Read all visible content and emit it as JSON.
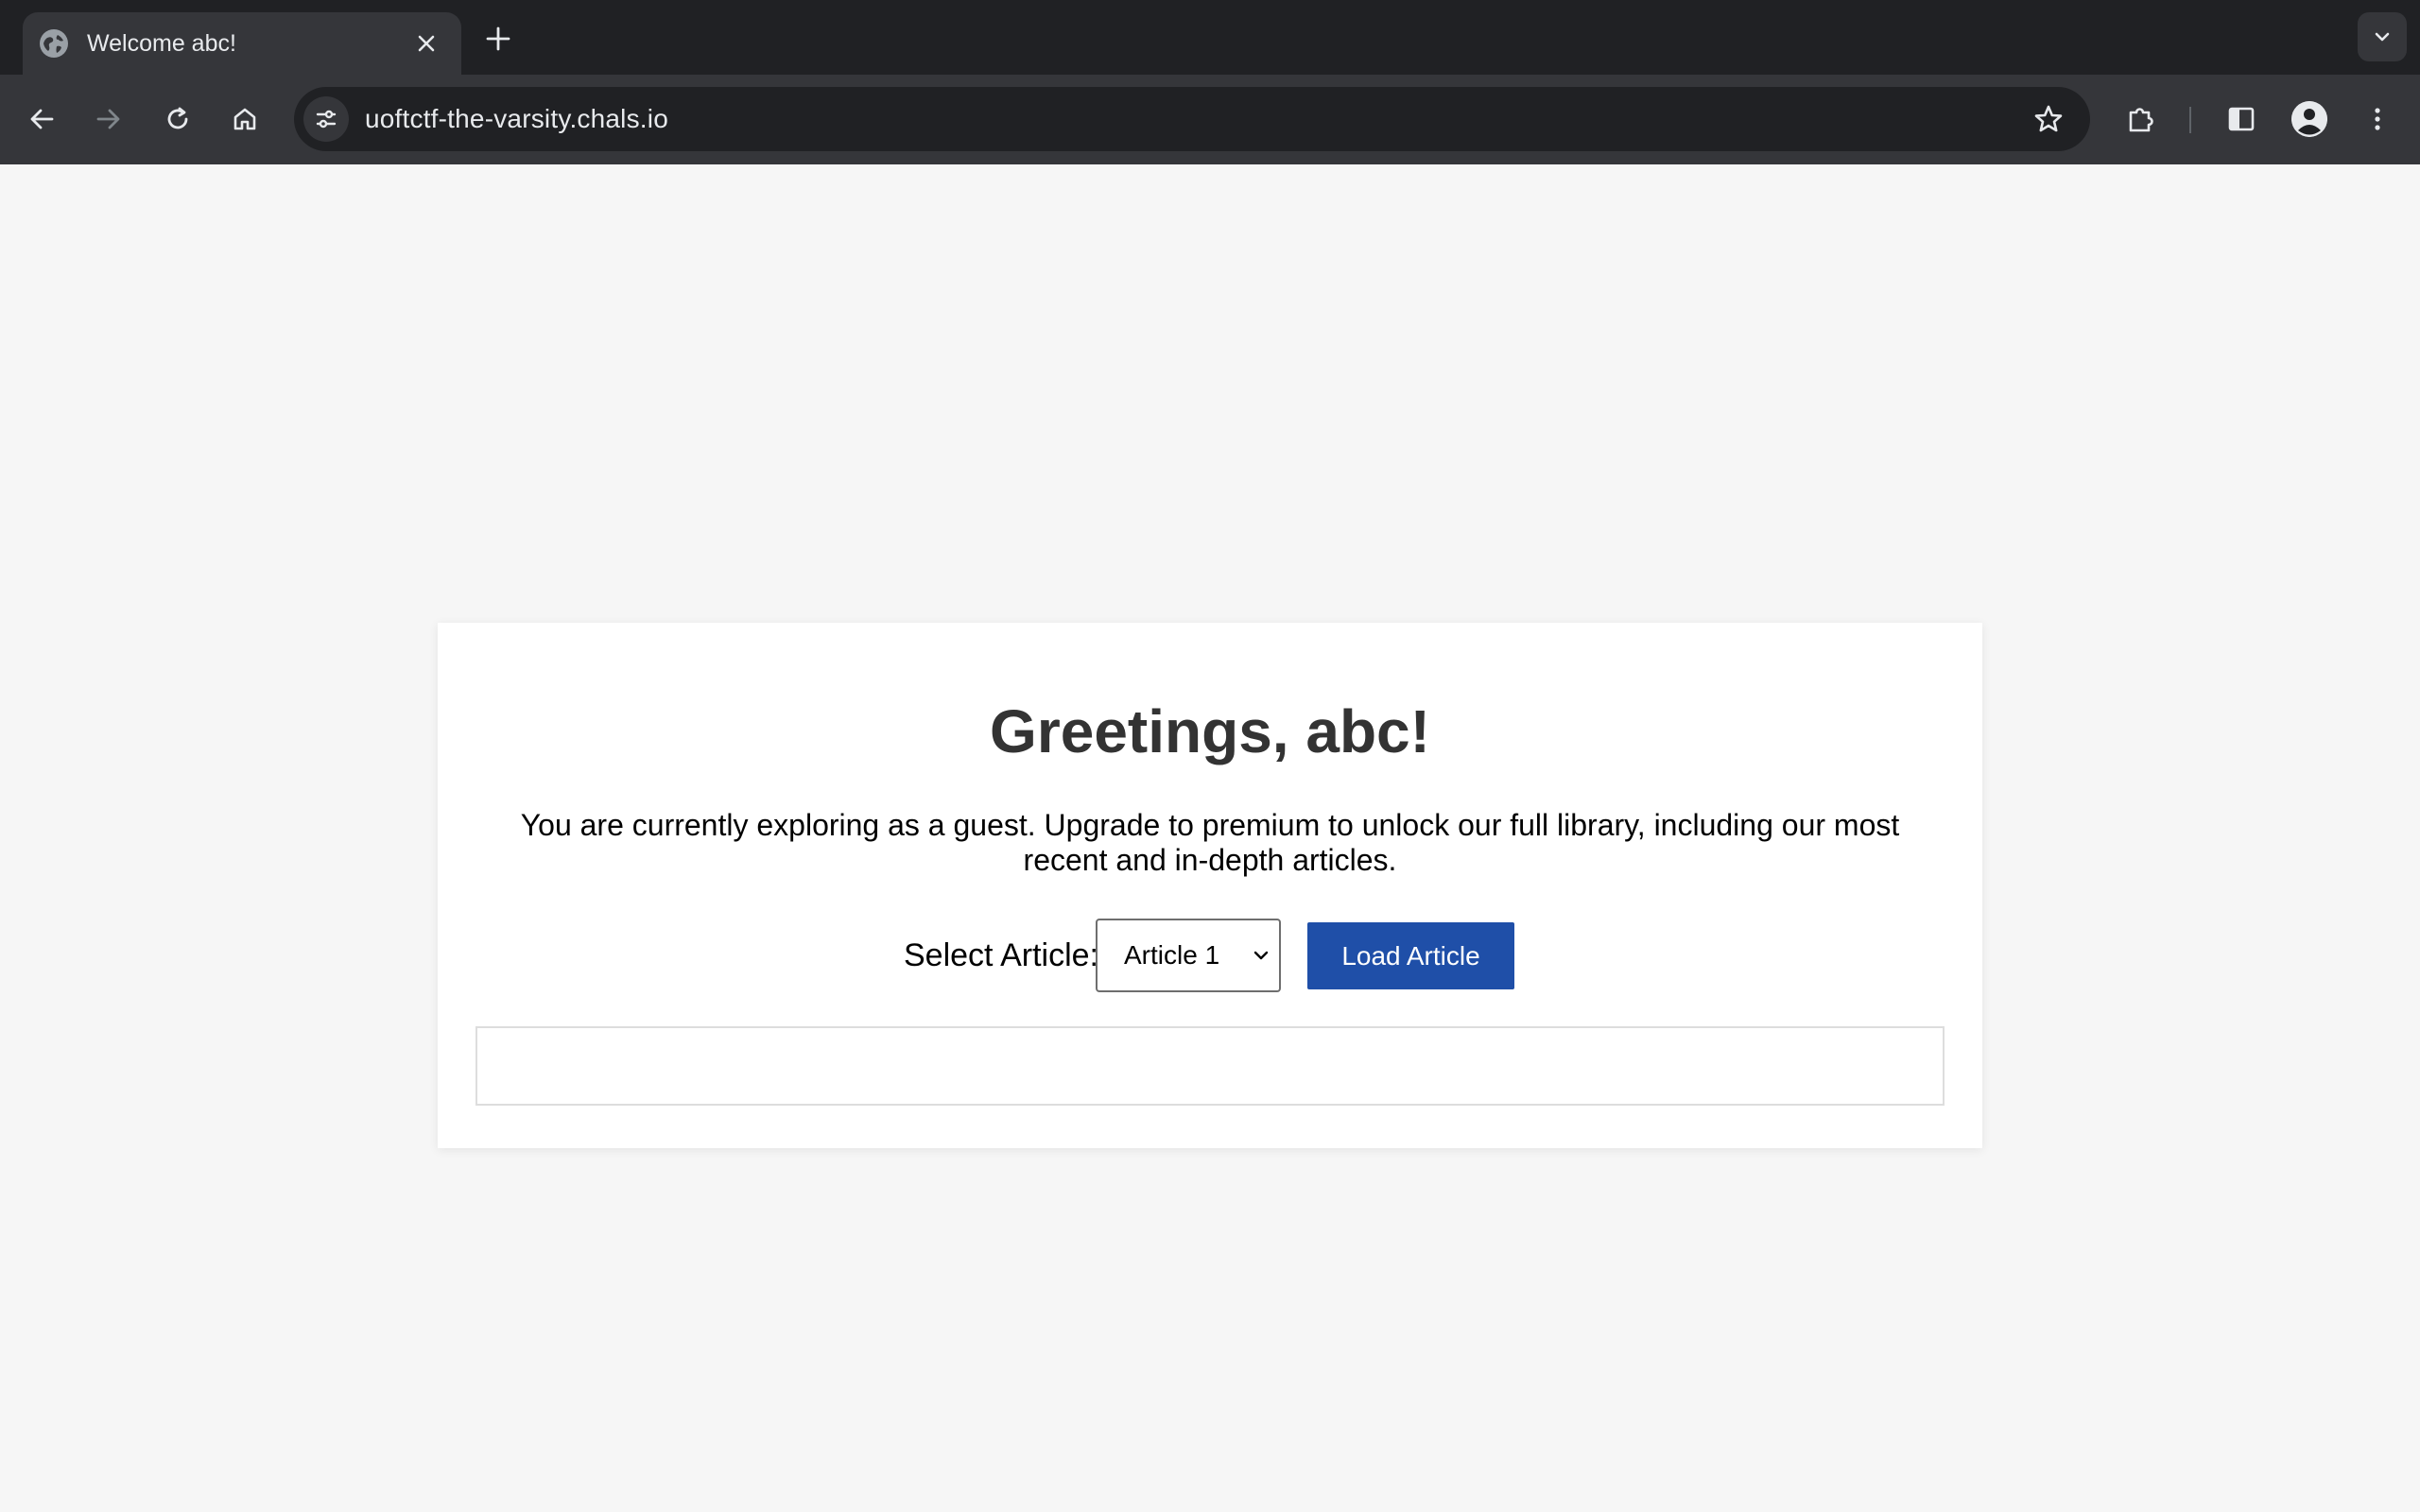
{
  "browser": {
    "tab": {
      "title": "Welcome abc!",
      "favicon_icon": "globe-icon",
      "close_icon": "close-icon"
    },
    "new_tab_icon": "plus-icon",
    "tab_search_icon": "chevron-down-icon",
    "nav": {
      "back_icon": "arrow-left-icon",
      "forward_icon": "arrow-right-icon",
      "reload_icon": "reload-icon",
      "home_icon": "home-icon"
    },
    "omnibox": {
      "site_info_icon": "tune-icon",
      "url": "uoftctf-the-varsity.chals.io",
      "bookmark_icon": "star-icon"
    },
    "toolbar_icons": [
      "puzzle-icon",
      "side-panel-icon",
      "profile-icon",
      "kebab-menu-icon"
    ]
  },
  "page": {
    "greeting": "Greetings, abc!",
    "intro": "You are currently exploring as a guest. Upgrade to premium to unlock our full library, including our most recent and in-depth articles.",
    "controls": {
      "select_label": "Select Article:",
      "selected_article": "Article 1",
      "load_button_label": "Load Article"
    },
    "article_content": ""
  },
  "colors": {
    "tabstrip_bg": "#202124",
    "toolbar_bg": "#35363a",
    "page_bg": "#f6f6f6",
    "button_bg": "#1f4fa8",
    "heading_text": "#333333"
  }
}
